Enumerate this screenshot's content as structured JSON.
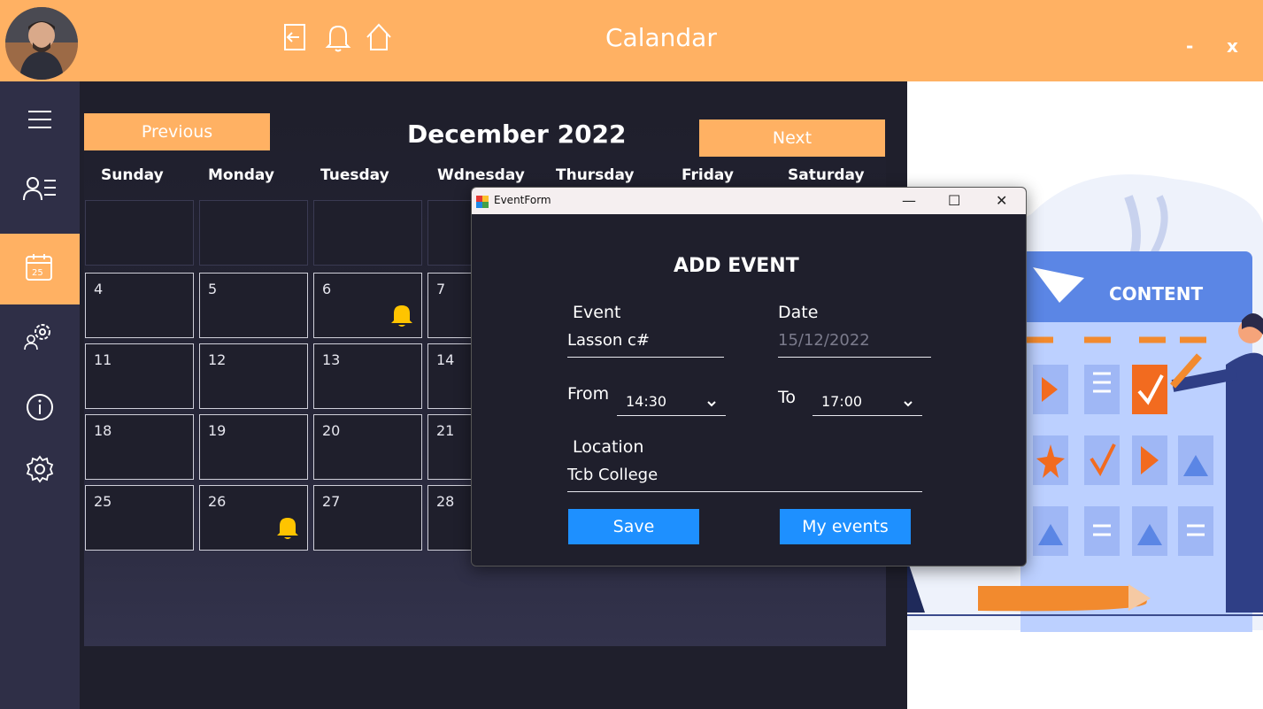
{
  "window": {
    "title": "Calandar",
    "minimize": "-",
    "close": "x"
  },
  "toolbar_icons": [
    "logout-icon",
    "bell-icon",
    "home-icon"
  ],
  "sidebar": {
    "items": [
      {
        "name": "menu-icon",
        "active": false
      },
      {
        "name": "profile-list-icon",
        "active": false
      },
      {
        "name": "calendar-icon",
        "active": true,
        "badge": "25"
      },
      {
        "name": "team-settings-icon",
        "active": false
      },
      {
        "name": "info-icon",
        "active": false
      },
      {
        "name": "gear-icon",
        "active": false
      }
    ]
  },
  "calendar": {
    "previous_label": "Previous",
    "next_label": "Next",
    "month_title": "December 2022",
    "weekdays": [
      "Sunday",
      "Monday",
      "Tuesday",
      "Wdnesday",
      "Thursday",
      "Friday",
      "Saturday"
    ],
    "rows": [
      [
        "",
        "",
        "",
        "",
        ""
      ],
      [
        "4",
        "5",
        "6",
        "7"
      ],
      [
        "11",
        "12",
        "13",
        "14"
      ],
      [
        "18",
        "19",
        "20",
        "21"
      ],
      [
        "25",
        "26",
        "27",
        "28"
      ]
    ],
    "bell_days": [
      "6",
      "26"
    ],
    "bell_color": "#ffc400"
  },
  "dialog": {
    "title": "EventForm",
    "minimize": "—",
    "maximize": "☐",
    "close": "✕",
    "heading": "ADD EVENT",
    "event_label": "Event",
    "event_value": "Lasson c#",
    "date_label": "Date",
    "date_value": "15/12/2022",
    "from_label": "From",
    "from_value": "14:30",
    "to_label": "To",
    "to_value": "17:00",
    "location_label": "Location",
    "location_value": "Tcb College",
    "save_label": "Save",
    "myevents_label": "My events",
    "button_color": "#1e90ff"
  },
  "illustration": {
    "board_label": "CONTENT"
  },
  "colors": {
    "accent": "#ffb163",
    "sidebar": "#2f2f47",
    "main": "#1f1f2c"
  }
}
